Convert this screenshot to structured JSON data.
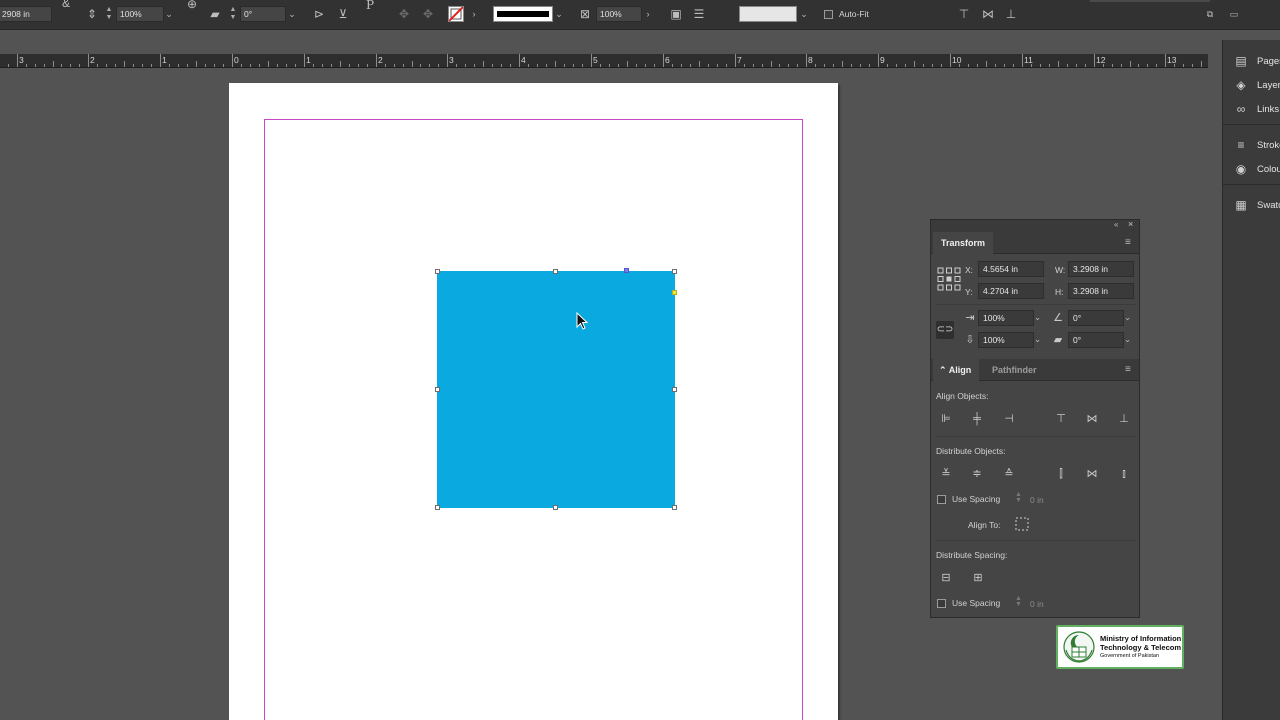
{
  "control_bar": {
    "ref_value": "2908 in",
    "scale_value": "100%",
    "rotate_value": "0°",
    "opacity_value": "100%",
    "auto_fit_label": "Auto-Fit"
  },
  "ruler": {
    "labels": [
      "3",
      "2",
      "1",
      "0",
      "1",
      "2",
      "3",
      "4",
      "5",
      "6",
      "7",
      "8",
      "9",
      "10",
      "11",
      "12",
      "13"
    ]
  },
  "document": {
    "rectangle_fill": "#0aaae0",
    "margin_guide_color": "#c846c8"
  },
  "dock": {
    "items": [
      {
        "label": "Pages",
        "icon": "pages-icon"
      },
      {
        "label": "Layers",
        "icon": "layers-icon"
      },
      {
        "label": "Links",
        "icon": "links-icon"
      },
      {
        "label": "Stroke",
        "icon": "stroke-icon"
      },
      {
        "label": "Colour",
        "icon": "colour-icon"
      },
      {
        "label": "Swatches",
        "icon": "swatches-icon"
      }
    ]
  },
  "transform": {
    "title": "Transform",
    "x_label": "X:",
    "x_value": "4.5654 in",
    "y_label": "Y:",
    "y_value": "4.2704 in",
    "w_label": "W:",
    "w_value": "3.2908 in",
    "h_label": "H:",
    "h_value": "3.2908 in",
    "scale_x": "100%",
    "scale_y": "100%",
    "rotation": "0°",
    "shear": "0°"
  },
  "align": {
    "tab_align": "Align",
    "tab_pathfinder": "Pathfinder",
    "align_objects_label": "Align Objects:",
    "distribute_objects_label": "Distribute Objects:",
    "use_spacing_label": "Use Spacing",
    "spacing_value_1": "0 in",
    "align_to_label": "Align To:",
    "distribute_spacing_label": "Distribute Spacing:",
    "use_spacing_label_2": "Use Spacing",
    "spacing_value_2": "0 in"
  },
  "logo": {
    "line1": "Ministry of Information",
    "line2": "Technology & Telecom",
    "line3": "Government of Pakistan",
    "border_color": "#5fb15f"
  }
}
